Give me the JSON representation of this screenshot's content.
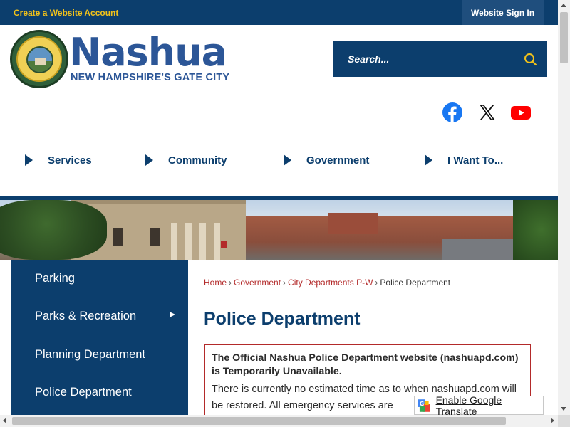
{
  "topbar": {
    "create_account": "Create a Website Account",
    "sign_in": "Website Sign In"
  },
  "header": {
    "logo_title": "Nashua",
    "logo_subtitle": "NEW HAMPSHIRE'S GATE CITY",
    "search_placeholder": "Search..."
  },
  "social": {
    "icons": [
      "facebook-icon",
      "x-icon",
      "youtube-icon"
    ]
  },
  "nav": {
    "items": [
      "Services",
      "Community",
      "Government",
      "I Want To..."
    ]
  },
  "sidebar": {
    "items": [
      "Parking",
      "Parks & Recreation",
      "Planning Department",
      "Police Department"
    ]
  },
  "breadcrumb": {
    "items": [
      "Home",
      "Government",
      "City Departments P-W",
      "Police Department"
    ],
    "separator": "›"
  },
  "page": {
    "title": "Police Department",
    "alert_heading": "The Official Nashua Police Department website (nashuapd.com) is Temporarily Unavailable.",
    "alert_text": "There is currently no estimated time as to when nashuapd.com will be restored. All emergency services are"
  },
  "translate": {
    "label": "Enable Google Translate"
  },
  "colors": {
    "brand_navy": "#0c3e6d",
    "accent_gold": "#f2c21a",
    "logo_blue": "#2c5697",
    "link_red": "#b32a2a"
  }
}
